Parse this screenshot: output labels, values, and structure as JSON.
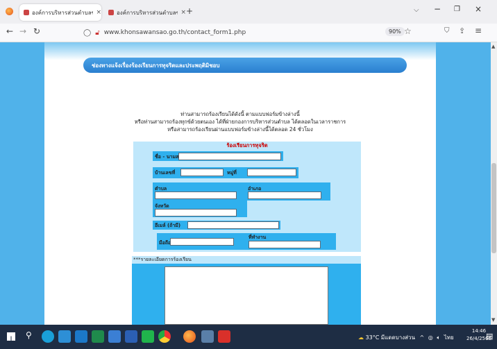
{
  "browser": {
    "tabs": [
      {
        "label": "องค์การบริหารส่วนตำบลขอนสวรรค์ อำเ"
      },
      {
        "label": "องค์การบริหารส่วนตำบลขอนสวรรค์ อำเ"
      }
    ],
    "new_tab": "+",
    "url": "www.khonsawansao.go.th/contact_form1.php",
    "zoom": "90%"
  },
  "page": {
    "banner": "ช่องทางแจ้งเรื่องร้องเรียนการทุจริตและประพฤติมิชอบ",
    "intro": [
      "ท่านสามารถร้องเรียนได้ดังนี้ ตามแบบฟอร์มข้างล่างนี้",
      "หรือท่านสามารถร้องทุกข์ด้วยตนเอง ได้ที่ฝ่ายกองการบริหารส่วนตำบล ได้ตลอดในเวลาราชการ",
      "หรือสามารถร้องเรียนผ่านแบบฟอร์มข้างล่างนี้ได้ตลอด 24 ชั่วโมง"
    ],
    "form_title": "ร้องเรียนการทุจริต",
    "fields": {
      "name": "ชื่อ - นามสกุล",
      "house_no": "บ้านเลขที่",
      "moo": "หมู่ที่",
      "tambon": "ตำบล",
      "amphoe": "อำเภอ",
      "province": "จังหวัด",
      "email": "อีเมล์ (ถ้ามี)",
      "phone": "มือถือ",
      "workplace": "ที่ทำงาน"
    },
    "detail_label": "***รายละเอียดการร้องเรียน"
  },
  "taskbar": {
    "weather": "33°C มีแดดบางส่วน",
    "lang": "ไทย",
    "time": "14:46",
    "date": "26/4/2566"
  },
  "colors": {
    "page_blue": "#2fb0ee",
    "band": "#bfe7fb",
    "form_title": "#cc0000",
    "taskbar": "#1e2d44"
  }
}
